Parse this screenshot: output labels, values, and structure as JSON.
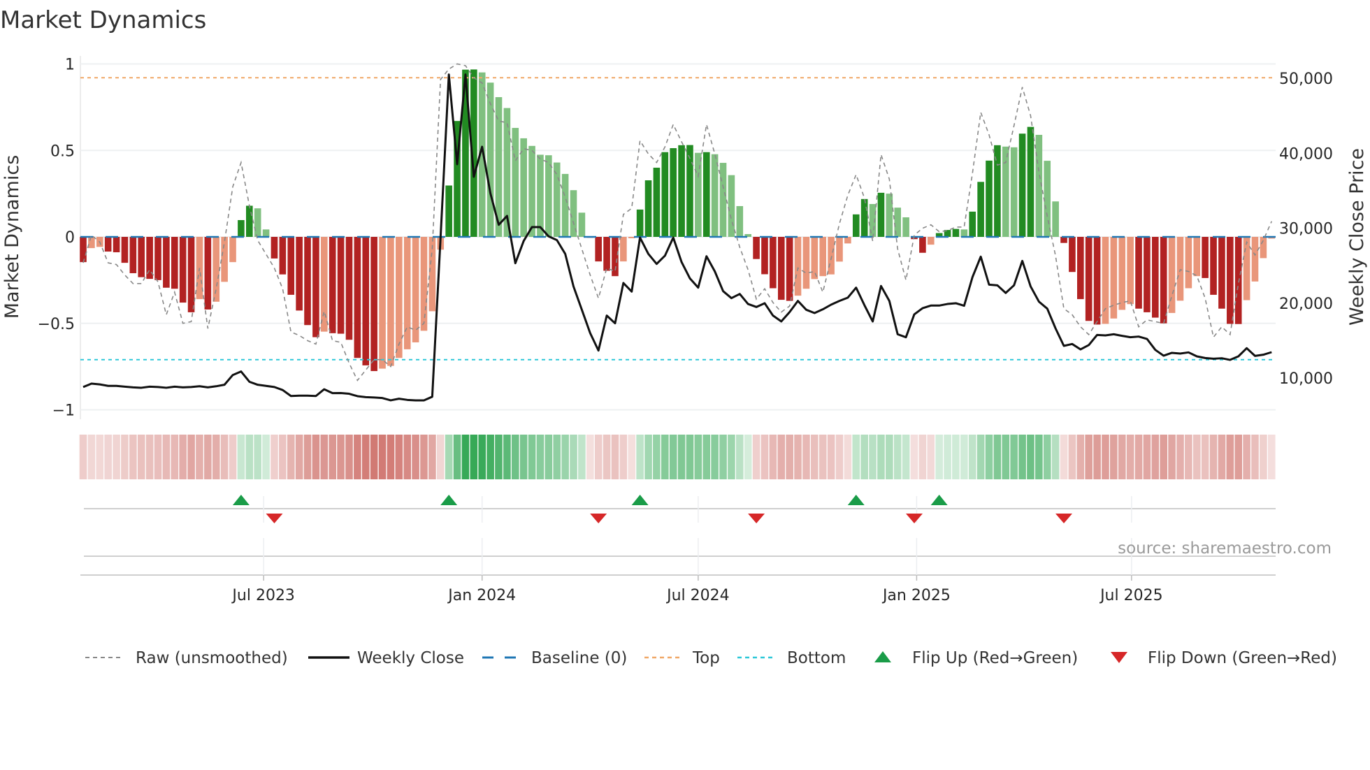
{
  "chart_data": {
    "type": "bar",
    "title": "Market Dynamics",
    "ylabel": "Market Dynamics",
    "y2label": "Weekly Close Price",
    "ylim": [
      -1,
      1
    ],
    "y2lim": [
      5000,
      52000
    ],
    "yticks": [
      1,
      0.5,
      0,
      -0.5,
      -1
    ],
    "ytick_labels": [
      "1",
      "0.5",
      "0",
      "−0.5",
      "−1"
    ],
    "y2ticks": [
      50000,
      40000,
      30000,
      20000,
      10000
    ],
    "y2tick_labels": [
      "50,000",
      "40,000",
      "30,000",
      "20,000",
      "10,000"
    ],
    "x_start_date": "2023-01-30",
    "x_interval_days": 7,
    "xticks": [
      "2023-07-01",
      "2024-01-01",
      "2024-07-01",
      "2025-01-01",
      "2025-07-01"
    ],
    "xtick_labels": [
      "Jul 2023",
      "Jan 2024",
      "Jul 2024",
      "Jan 2025",
      "Jul 2025"
    ],
    "grid": true,
    "legend_position": "bottom",
    "top_level": 0.92,
    "bottom_level": -0.71,
    "baseline": 0,
    "source": "source: sharemaestro.com",
    "colors": {
      "dark_red": "#b22222",
      "light_red": "#e9967a",
      "dark_green": "#228b22",
      "light_green": "#80c080",
      "raw": "#888888",
      "close": "#111111",
      "baseline": "#1f77b4",
      "top": "#f0a868",
      "bottom": "#2ec8d8",
      "flip_up": "#1a9c48",
      "flip_down": "#d62728"
    },
    "series": [
      {
        "name": "Market Dynamics (smoothed)",
        "values": [
          -0.146,
          -0.065,
          -0.058,
          -0.085,
          -0.089,
          -0.15,
          -0.21,
          -0.233,
          -0.243,
          -0.25,
          -0.294,
          -0.3,
          -0.38,
          -0.436,
          -0.36,
          -0.42,
          -0.375,
          -0.26,
          -0.146,
          0.097,
          0.18,
          0.165,
          0.043,
          -0.125,
          -0.217,
          -0.335,
          -0.426,
          -0.51,
          -0.58,
          -0.548,
          -0.557,
          -0.56,
          -0.595,
          -0.7,
          -0.743,
          -0.776,
          -0.762,
          -0.746,
          -0.7,
          -0.65,
          -0.61,
          -0.543,
          -0.43,
          -0.074,
          0.297,
          0.67,
          0.967,
          0.968,
          0.951,
          0.892,
          0.808,
          0.745,
          0.63,
          0.57,
          0.526,
          0.475,
          0.472,
          0.43,
          0.364,
          0.27,
          0.14,
          -0.005,
          -0.142,
          -0.196,
          -0.227,
          -0.142,
          -0.008,
          0.158,
          0.327,
          0.4,
          0.49,
          0.513,
          0.53,
          0.531,
          0.486,
          0.49,
          0.478,
          0.428,
          0.357,
          0.178,
          0.016,
          -0.128,
          -0.216,
          -0.297,
          -0.364,
          -0.37,
          -0.34,
          -0.3,
          -0.244,
          -0.227,
          -0.217,
          -0.143,
          -0.038,
          0.13,
          0.219,
          0.19,
          0.255,
          0.25,
          0.169,
          0.113,
          -0.013,
          -0.092,
          -0.045,
          0.022,
          0.04,
          0.046,
          0.043,
          0.146,
          0.318,
          0.441,
          0.53,
          0.522,
          0.518,
          0.597,
          0.636,
          0.59,
          0.44,
          0.205,
          -0.035,
          -0.203,
          -0.36,
          -0.486,
          -0.507,
          -0.503,
          -0.472,
          -0.422,
          -0.389,
          -0.415,
          -0.436,
          -0.467,
          -0.5,
          -0.44,
          -0.369,
          -0.297,
          -0.227,
          -0.238,
          -0.335,
          -0.415,
          -0.503,
          -0.504,
          -0.366,
          -0.258,
          -0.123,
          -0.01
        ]
      },
      {
        "name": "Raw (unsmoothed)",
        "values": [
          -0.15,
          0.01,
          -0.03,
          -0.15,
          -0.16,
          -0.22,
          -0.27,
          -0.27,
          -0.19,
          -0.26,
          -0.45,
          -0.32,
          -0.5,
          -0.49,
          -0.18,
          -0.53,
          -0.3,
          -0.03,
          0.29,
          0.43,
          0.18,
          -0.02,
          -0.1,
          -0.18,
          -0.3,
          -0.55,
          -0.57,
          -0.6,
          -0.62,
          -0.43,
          -0.6,
          -0.61,
          -0.73,
          -0.83,
          -0.77,
          -0.71,
          -0.71,
          -0.75,
          -0.62,
          -0.52,
          -0.54,
          -0.5,
          -0.07,
          0.91,
          0.97,
          1.0,
          0.99,
          0.92,
          0.89,
          0.77,
          0.67,
          0.66,
          0.44,
          0.51,
          0.5,
          0.45,
          0.43,
          0.36,
          0.23,
          0.08,
          -0.07,
          -0.22,
          -0.355,
          -0.18,
          -0.2,
          0.13,
          0.165,
          0.556,
          0.48,
          0.43,
          0.52,
          0.65,
          0.55,
          0.455,
          0.35,
          0.65,
          0.48,
          0.29,
          0.1,
          -0.06,
          -0.19,
          -0.36,
          -0.3,
          -0.38,
          -0.435,
          -0.4,
          -0.18,
          -0.21,
          -0.2,
          -0.32,
          -0.125,
          0.077,
          0.24,
          0.36,
          0.225,
          -0.025,
          0.476,
          0.334,
          -0.07,
          -0.25,
          0.01,
          0.05,
          0.07,
          0.03,
          0.036,
          0.057,
          0.057,
          0.367,
          0.72,
          0.59,
          0.415,
          0.43,
          0.643,
          0.866,
          0.7,
          0.375,
          0.12,
          -0.11,
          -0.415,
          -0.45,
          -0.52,
          -0.565,
          -0.49,
          -0.415,
          -0.395,
          -0.38,
          -0.37,
          -0.52,
          -0.48,
          -0.49,
          -0.5,
          -0.34,
          -0.19,
          -0.2,
          -0.225,
          -0.355,
          -0.58,
          -0.52,
          -0.565,
          -0.27,
          -0.03,
          -0.105,
          -0.02,
          0.09
        ]
      },
      {
        "name": "Weekly Close",
        "axis": "right",
        "values": [
          8800,
          9250,
          9150,
          8950,
          8950,
          8850,
          8750,
          8700,
          8850,
          8800,
          8700,
          8850,
          8750,
          8800,
          8900,
          8750,
          8900,
          9100,
          10400,
          10870,
          9500,
          9100,
          8950,
          8800,
          8400,
          7600,
          7650,
          7650,
          7600,
          8500,
          7980,
          8000,
          7900,
          7580,
          7450,
          7400,
          7330,
          7020,
          7240,
          7080,
          7020,
          7020,
          7500,
          28700,
          50500,
          38530,
          50500,
          36850,
          40860,
          34640,
          30450,
          31630,
          25320,
          28280,
          30140,
          30140,
          28900,
          28400,
          26570,
          22210,
          19110,
          16000,
          13670,
          18330,
          17300,
          22680,
          21530,
          28740,
          26570,
          25230,
          26320,
          28740,
          25480,
          23300,
          22060,
          26250,
          24230,
          21590,
          20660,
          21220,
          19880,
          19480,
          19980,
          18330,
          17550,
          18800,
          20290,
          19110,
          18670,
          19170,
          19790,
          20290,
          20720,
          22060,
          19730,
          17550,
          22280,
          20290,
          15840,
          15440,
          18490,
          19320,
          19670,
          19670,
          19880,
          19980,
          19640,
          23450,
          26190,
          22460,
          22370,
          21350,
          22370,
          25630,
          22220,
          20190,
          19260,
          16620,
          14290,
          14540,
          13820,
          14400,
          15750,
          15690,
          15840,
          15630,
          15440,
          15530,
          15220,
          13760,
          12980,
          13360,
          13260,
          13420,
          12890,
          12670,
          12580,
          12640,
          12420,
          12890,
          13980,
          12950,
          13110,
          13450
        ]
      }
    ],
    "flip_up_weeks": [
      20,
      45,
      68,
      94,
      104
    ],
    "flip_down_weeks": [
      24,
      63,
      82,
      101,
      119
    ],
    "legend": [
      {
        "key": "raw",
        "label": "Raw (unsmoothed)"
      },
      {
        "key": "close",
        "label": "Weekly Close"
      },
      {
        "key": "baseline",
        "label": "Baseline (0)"
      },
      {
        "key": "top",
        "label": "Top"
      },
      {
        "key": "bottom",
        "label": "Bottom"
      },
      {
        "key": "flip_up",
        "label": "Flip Up (Red→Green)"
      },
      {
        "key": "flip_down",
        "label": "Flip Down (Green→Red)"
      }
    ]
  }
}
